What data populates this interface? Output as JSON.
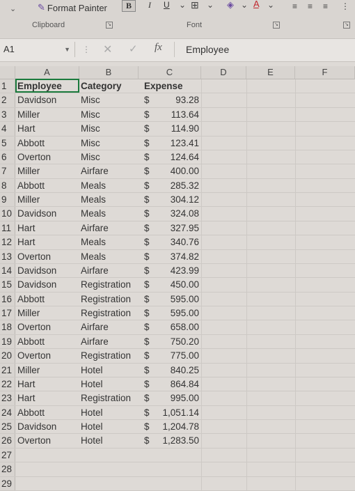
{
  "ribbon": {
    "format_painter": "Format Painter",
    "clipboard_label": "Clipboard",
    "font_label": "Font",
    "bold_label": "B",
    "italic_label": "I",
    "underline_label": "U"
  },
  "formula_bar": {
    "cell_ref": "A1",
    "fx": "fx",
    "value": "Employee"
  },
  "columns": [
    "A",
    "B",
    "C",
    "D",
    "E",
    "F"
  ],
  "rows": [
    {
      "n": "1",
      "a": "Employee",
      "b": "Category",
      "c": "Expense",
      "d": "",
      "hdr": true
    },
    {
      "n": "2",
      "a": "Davidson",
      "b": "Misc",
      "d": "$",
      "e": "93.28"
    },
    {
      "n": "3",
      "a": "Miller",
      "b": "Misc",
      "d": "$",
      "e": "113.64"
    },
    {
      "n": "4",
      "a": "Hart",
      "b": "Misc",
      "d": "$",
      "e": "114.90"
    },
    {
      "n": "5",
      "a": "Abbott",
      "b": "Misc",
      "d": "$",
      "e": "123.41"
    },
    {
      "n": "6",
      "a": "Overton",
      "b": "Misc",
      "d": "$",
      "e": "124.64"
    },
    {
      "n": "7",
      "a": "Miller",
      "b": "Airfare",
      "d": "$",
      "e": "400.00"
    },
    {
      "n": "8",
      "a": "Abbott",
      "b": "Meals",
      "d": "$",
      "e": "285.32"
    },
    {
      "n": "9",
      "a": "Miller",
      "b": "Meals",
      "d": "$",
      "e": "304.12"
    },
    {
      "n": "10",
      "a": "Davidson",
      "b": "Meals",
      "d": "$",
      "e": "324.08"
    },
    {
      "n": "11",
      "a": "Hart",
      "b": "Airfare",
      "d": "$",
      "e": "327.95"
    },
    {
      "n": "12",
      "a": "Hart",
      "b": "Meals",
      "d": "$",
      "e": "340.76"
    },
    {
      "n": "13",
      "a": "Overton",
      "b": "Meals",
      "d": "$",
      "e": "374.82"
    },
    {
      "n": "14",
      "a": "Davidson",
      "b": "Airfare",
      "d": "$",
      "e": "423.99"
    },
    {
      "n": "15",
      "a": "Davidson",
      "b": "Registration",
      "d": "$",
      "e": "450.00"
    },
    {
      "n": "16",
      "a": "Abbott",
      "b": "Registration",
      "d": "$",
      "e": "595.00"
    },
    {
      "n": "17",
      "a": "Miller",
      "b": "Registration",
      "d": "$",
      "e": "595.00"
    },
    {
      "n": "18",
      "a": "Overton",
      "b": "Airfare",
      "d": "$",
      "e": "658.00"
    },
    {
      "n": "19",
      "a": "Abbott",
      "b": "Airfare",
      "d": "$",
      "e": "750.20"
    },
    {
      "n": "20",
      "a": "Overton",
      "b": "Registration",
      "d": "$",
      "e": "775.00"
    },
    {
      "n": "21",
      "a": "Miller",
      "b": "Hotel",
      "d": "$",
      "e": "840.25"
    },
    {
      "n": "22",
      "a": "Hart",
      "b": "Hotel",
      "d": "$",
      "e": "864.84"
    },
    {
      "n": "23",
      "a": "Hart",
      "b": "Registration",
      "d": "$",
      "e": "995.00"
    },
    {
      "n": "24",
      "a": "Abbott",
      "b": "Hotel",
      "d": "$",
      "e": "1,051.14"
    },
    {
      "n": "25",
      "a": "Davidson",
      "b": "Hotel",
      "d": "$",
      "e": "1,204.78"
    },
    {
      "n": "26",
      "a": "Overton",
      "b": "Hotel",
      "d": "$",
      "e": "1,283.50"
    },
    {
      "n": "27"
    },
    {
      "n": "28"
    },
    {
      "n": "29"
    }
  ]
}
